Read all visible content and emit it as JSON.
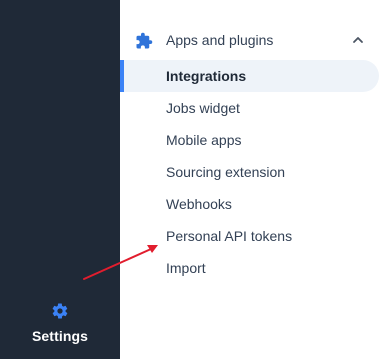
{
  "rail": {
    "settings_label": "Settings",
    "settings_icon": "gear-icon",
    "background": "#1f2937",
    "icon_color": "#3b82f6"
  },
  "section": {
    "title": "Apps and plugins",
    "icon": "puzzle-icon",
    "expanded_icon": "chevron-up-icon",
    "icon_color": "#2f73d9"
  },
  "menu": {
    "items": [
      {
        "label": "Integrations",
        "active": true
      },
      {
        "label": "Jobs widget",
        "active": false
      },
      {
        "label": "Mobile apps",
        "active": false
      },
      {
        "label": "Sourcing extension",
        "active": false
      },
      {
        "label": "Webhooks",
        "active": false
      },
      {
        "label": "Personal API tokens",
        "active": false
      },
      {
        "label": "Import",
        "active": false
      }
    ]
  },
  "annotation": {
    "arrow_color": "#e11d2e"
  },
  "colors": {
    "active_bg": "#eef3f9",
    "active_bar": "#3b82f6",
    "text": "#334155"
  }
}
